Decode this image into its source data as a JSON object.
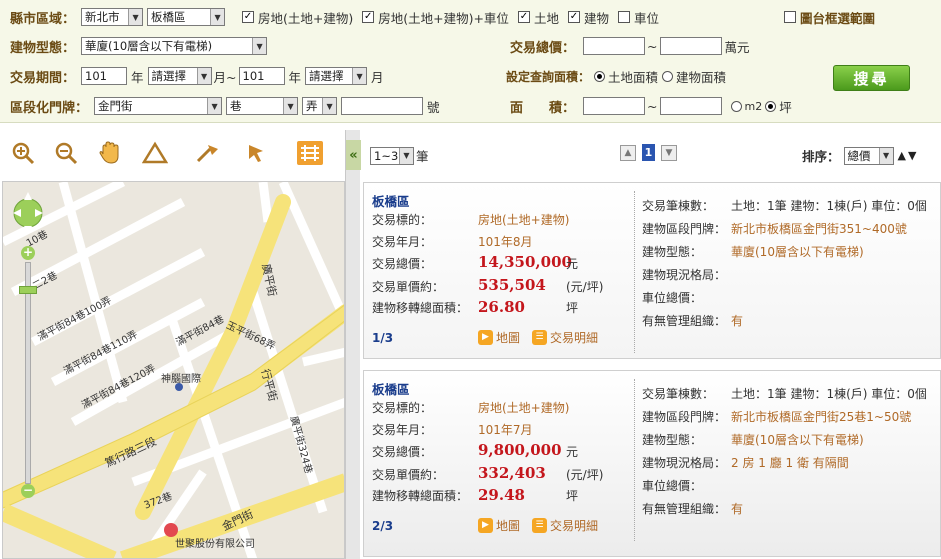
{
  "search": {
    "county_label": "縣市區域：",
    "county_value": "新北市",
    "district_value": "板橋區",
    "filters": [
      {
        "label": "房地(土地+建物)",
        "checked": true
      },
      {
        "label": "房地(土地+建物)+車位",
        "checked": true
      },
      {
        "label": "土地",
        "checked": true
      },
      {
        "label": "建物",
        "checked": true
      },
      {
        "label": "車位",
        "checked": false
      }
    ],
    "map_select_label": "圖台框選範圍",
    "building_type_label": "建物型態：",
    "building_type_value": "華廈(10層含以下有電梯)",
    "total_price_label": "交易總價：",
    "total_price_sep": "~",
    "total_price_unit": "萬元",
    "period_label": "交易期間：",
    "period_from_year": "101",
    "year_unit": "年",
    "month_placeholder": "請選擇",
    "month_unit_sep": "月~",
    "period_to_year": "101",
    "month_unit": "月",
    "area_setting_label": "設定查詢面積：",
    "area_opt_land": "土地面積",
    "area_opt_building": "建物面積",
    "search_button": "搜尋",
    "address_label": "區段化門牌：",
    "road_value": "金門街",
    "lane_value": "巷",
    "alley_value": "弄",
    "number_unit": "號",
    "area_label": "面　　積：",
    "area_sep": "~",
    "unit_m2": "m2",
    "unit_ping": "坪"
  },
  "toolbar": {
    "icons": [
      "zoom-in-icon",
      "zoom-out-icon",
      "pan-hand-icon",
      "measure-area-icon",
      "measure-distance-icon",
      "select-icon",
      "layers-icon"
    ]
  },
  "map": {
    "labels": {
      "lane10": "10巷",
      "lane2": "二2巷",
      "lane100": "滿平街84巷100弄",
      "lane110": "滿平街84巷110弄",
      "lane120": "滿平街84巷120弄",
      "lane84": "滿平街84巷",
      "yuping": "玉平街68弄",
      "guangping": "廣平街",
      "shenao": "神腦國際",
      "duxing": "篤行路三段",
      "duxing2": "篤行路三段",
      "xingping": "行平街",
      "lane324": "廣平街324巷",
      "lane372": "372巷",
      "jinmen": "金門街",
      "shijie": "世聚股份有限公司"
    }
  },
  "results": {
    "per_page_value": "1~3",
    "per_page_unit": "筆",
    "page_current": "1",
    "sort_label": "排序：",
    "sort_value": "總價",
    "records": [
      {
        "district": "板橋區",
        "k_target": "交易標的：",
        "target": "房地(土地+建物)",
        "k_date": "交易年月：",
        "date": "101年8月",
        "k_total": "交易總價：",
        "total": "14,350,000",
        "total_unit": "元",
        "k_unit_price": "交易單價約：",
        "unit_price": "535,504",
        "unit_price_unit": "(元/坪)",
        "k_area": "建物移轉總面積：",
        "area": "26.80",
        "area_unit": "坪",
        "page": "1/3",
        "map_link": "地圖",
        "detail_link": "交易明細",
        "k_count": "交易筆棟數：",
        "count": "土地：1筆 建物：1棟(戶) 車位：0個",
        "k_address": "建物區段門牌：",
        "address": "新北市板橋區金門街351~400號",
        "k_form": "建物型態：",
        "form": "華廈(10層含以下有電梯)",
        "k_layout": "建物現況格局：",
        "layout": "",
        "k_parking": "車位總價：",
        "parking": "",
        "k_mgmt": "有無管理組織：",
        "mgmt": "有"
      },
      {
        "district": "板橋區",
        "k_target": "交易標的：",
        "target": "房地(土地+建物)",
        "k_date": "交易年月：",
        "date": "101年7月",
        "k_total": "交易總價：",
        "total": "9,800,000",
        "total_unit": "元",
        "k_unit_price": "交易單價約：",
        "unit_price": "332,403",
        "unit_price_unit": "(元/坪)",
        "k_area": "建物移轉總面積：",
        "area": "29.48",
        "area_unit": "坪",
        "page": "2/3",
        "map_link": "地圖",
        "detail_link": "交易明細",
        "k_count": "交易筆棟數：",
        "count": "土地：1筆 建物：1棟(戶) 車位：0個",
        "k_address": "建物區段門牌：",
        "address": "新北市板橋區金門街25巷1~50號",
        "k_form": "建物型態：",
        "form": "華廈(10層含以下有電梯)",
        "k_layout": "建物現況格局：",
        "layout": "2 房 1 廳 1 衛 有隔間",
        "k_parking": "車位總價：",
        "parking": "",
        "k_mgmt": "有無管理組織：",
        "mgmt": "有"
      }
    ]
  }
}
